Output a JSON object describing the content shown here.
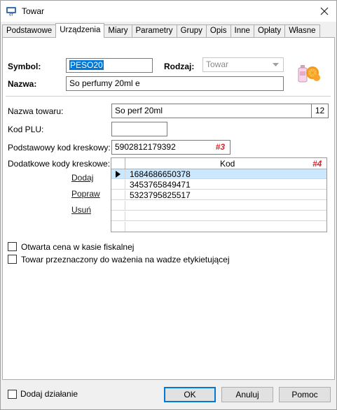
{
  "window": {
    "title": "Towar"
  },
  "tabs": [
    {
      "label": "Podstawowe",
      "active": false
    },
    {
      "label": "Urządzenia",
      "active": true
    },
    {
      "label": "Miary",
      "active": false
    },
    {
      "label": "Parametry",
      "active": false
    },
    {
      "label": "Grupy",
      "active": false
    },
    {
      "label": "Opis",
      "active": false
    },
    {
      "label": "Inne",
      "active": false
    },
    {
      "label": "Opłaty",
      "active": false
    },
    {
      "label": "Własne",
      "active": false
    }
  ],
  "header": {
    "symbol_label": "Symbol:",
    "symbol_value": "PESO20",
    "rodzaj_label": "Rodzaj:",
    "rodzaj_value": "Towar",
    "nazwa_label": "Nazwa:",
    "nazwa_value": "So perfumy 20ml e"
  },
  "fields": {
    "nazwa_towaru_label": "Nazwa towaru:",
    "nazwa_towaru_value": "So perf 20ml",
    "nazwa_towaru_count": "12",
    "kod_plu_label": "Kod PLU:",
    "kod_plu_value": "",
    "podstawowy_label": "Podstawowy kod kreskowy:",
    "podstawowy_value": "5902812179392",
    "podstawowy_marker": "#3",
    "dodatkowe_label": "Dodatkowe kody kreskowe:"
  },
  "barcode_actions": {
    "add": "Dodaj",
    "edit": "Popraw",
    "delete": "Usuń"
  },
  "barcode_grid": {
    "column_header": "Kod",
    "marker": "#4",
    "rows": [
      "1684686650378",
      "3453765849471",
      "5323795825517"
    ]
  },
  "options": {
    "open_price": "Otwarta cena w kasie fiskalnej",
    "weighing": "Towar przeznaczony do ważenia na wadze etykietującej"
  },
  "footer": {
    "add_action": "Dodaj działanie",
    "ok": "OK",
    "cancel": "Anuluj",
    "help": "Pomoc"
  },
  "colors": {
    "selection": "#0078d7",
    "marker_red": "#e0242c",
    "row_selected": "#cce8ff"
  }
}
